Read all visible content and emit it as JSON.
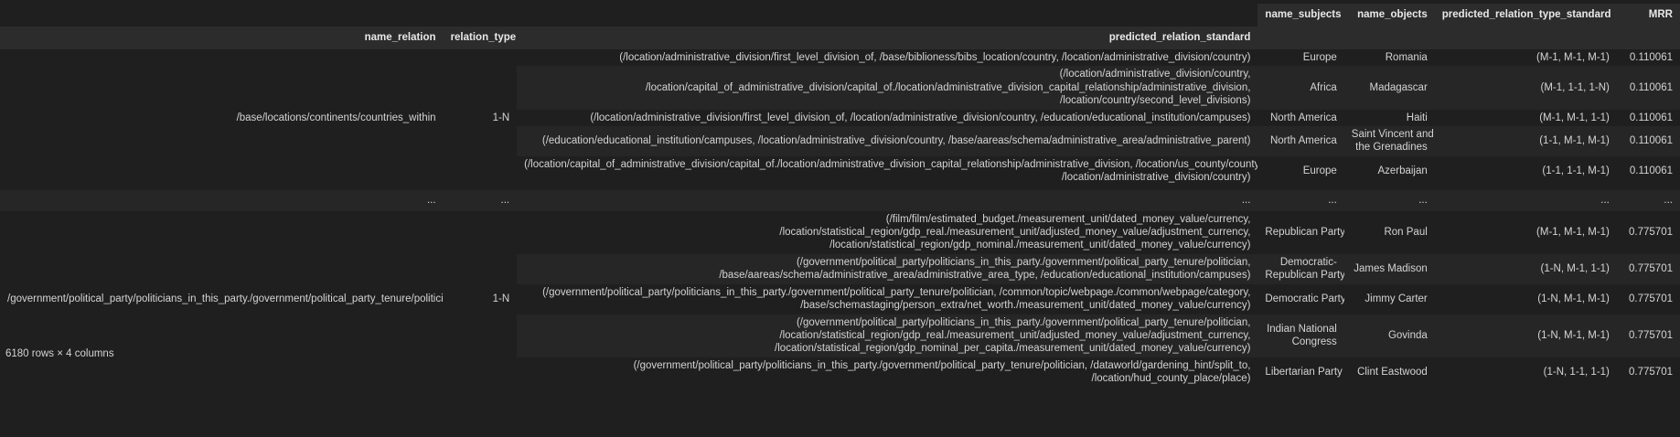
{
  "columns": {
    "name_relation": "name_relation",
    "relation_type": "relation_type",
    "predicted_relation_standard": "predicted_relation_standard",
    "name_subjects": "name_subjects",
    "name_objects": "name_objects",
    "predicted_relation_type_standard": "predicted_relation_type_standard",
    "MRR": "MRR"
  },
  "groups": [
    {
      "name_relation": "/base/locations/continents/countries_within",
      "relation_type": "1-N",
      "rows": [
        {
          "pred_lines": [
            "(/location/administrative_division/first_level_division_of, /base/biblioness/bibs_location/country, /location/administrative_division/country)"
          ],
          "subjects": "Europe",
          "objects": "Romania",
          "type_std": "(M-1, M-1, M-1)",
          "mrr": "0.110061"
        },
        {
          "pred_lines": [
            "(/location/administrative_division/country,",
            "/location/capital_of_administrative_division/capital_of./location/administrative_division_capital_relationship/administrative_division,",
            "/location/country/second_level_divisions)"
          ],
          "subjects": "Africa",
          "objects": "Madagascar",
          "type_std": "(M-1, 1-1, 1-N)",
          "mrr": "0.110061"
        },
        {
          "pred_lines": [
            "(/location/administrative_division/first_level_division_of, /location/administrative_division/country, /education/educational_institution/campuses)"
          ],
          "subjects": "North America",
          "objects": "Haiti",
          "type_std": "(M-1, M-1, 1-1)",
          "mrr": "0.110061"
        },
        {
          "pred_lines": [
            "(/education/educational_institution/campuses, /location/administrative_division/country, /base/aareas/schema/administrative_area/administrative_parent)"
          ],
          "subjects": "North America",
          "objects_lines": [
            "Saint Vincent and",
            "the Grenadines"
          ],
          "type_std": "(1-1, M-1, M-1)",
          "mrr": "0.110061"
        },
        {
          "pred_lines": [
            "(/location/capital_of_administrative_division/capital_of./location/administrative_division_capital_relationship/administrative_division, /location/us_county/county_seat,",
            "/location/administrative_division/country)"
          ],
          "subjects": "Europe",
          "objects": "Azerbaijan",
          "type_std": "(1-1, 1-1, M-1)",
          "mrr": "0.110061"
        }
      ]
    },
    {
      "name_relation": "/government/political_party/politicians_in_this_party./government/political_party_tenure/politician",
      "relation_type": "1-N",
      "rows": [
        {
          "pred_lines": [
            "(/film/film/estimated_budget./measurement_unit/dated_money_value/currency,",
            "/location/statistical_region/gdp_real./measurement_unit/adjusted_money_value/adjustment_currency,",
            "/location/statistical_region/gdp_nominal./measurement_unit/dated_money_value/currency)"
          ],
          "subjects": "Republican Party",
          "objects": "Ron Paul",
          "type_std": "(M-1, M-1, M-1)",
          "mrr": "0.775701"
        },
        {
          "pred_lines": [
            "(/government/political_party/politicians_in_this_party./government/political_party_tenure/politician,",
            "/base/aareas/schema/administrative_area/administrative_area_type, /education/educational_institution/campuses)"
          ],
          "subjects_lines": [
            "Democratic-",
            "Republican Party"
          ],
          "objects": "James Madison",
          "type_std": "(1-N, M-1, 1-1)",
          "mrr": "0.775701"
        },
        {
          "pred_lines": [
            "(/government/political_party/politicians_in_this_party./government/political_party_tenure/politician, /common/topic/webpage./common/webpage/category,",
            "/base/schemastaging/person_extra/net_worth./measurement_unit/dated_money_value/currency)"
          ],
          "subjects": "Democratic Party",
          "objects": "Jimmy Carter",
          "type_std": "(1-N, M-1, M-1)",
          "mrr": "0.775701"
        },
        {
          "pred_lines": [
            "(/government/political_party/politicians_in_this_party./government/political_party_tenure/politician,",
            "/location/statistical_region/gdp_real./measurement_unit/adjusted_money_value/adjustment_currency,",
            "/location/statistical_region/gdp_nominal_per_capita./measurement_unit/dated_money_value/currency)"
          ],
          "subjects_lines": [
            "Indian National",
            "Congress"
          ],
          "objects": "Govinda",
          "type_std": "(1-N, M-1, M-1)",
          "mrr": "0.775701"
        },
        {
          "pred_lines": [
            "(/government/political_party/politicians_in_this_party./government/political_party_tenure/politician, /dataworld/gardening_hint/split_to,",
            "/location/hud_county_place/place)"
          ],
          "subjects": "Libertarian Party",
          "objects": "Clint Eastwood",
          "type_std": "(1-N, 1-1, 1-1)",
          "mrr": "0.775701"
        }
      ]
    }
  ],
  "ellipsis": "...",
  "footer": "6180 rows × 4 columns"
}
